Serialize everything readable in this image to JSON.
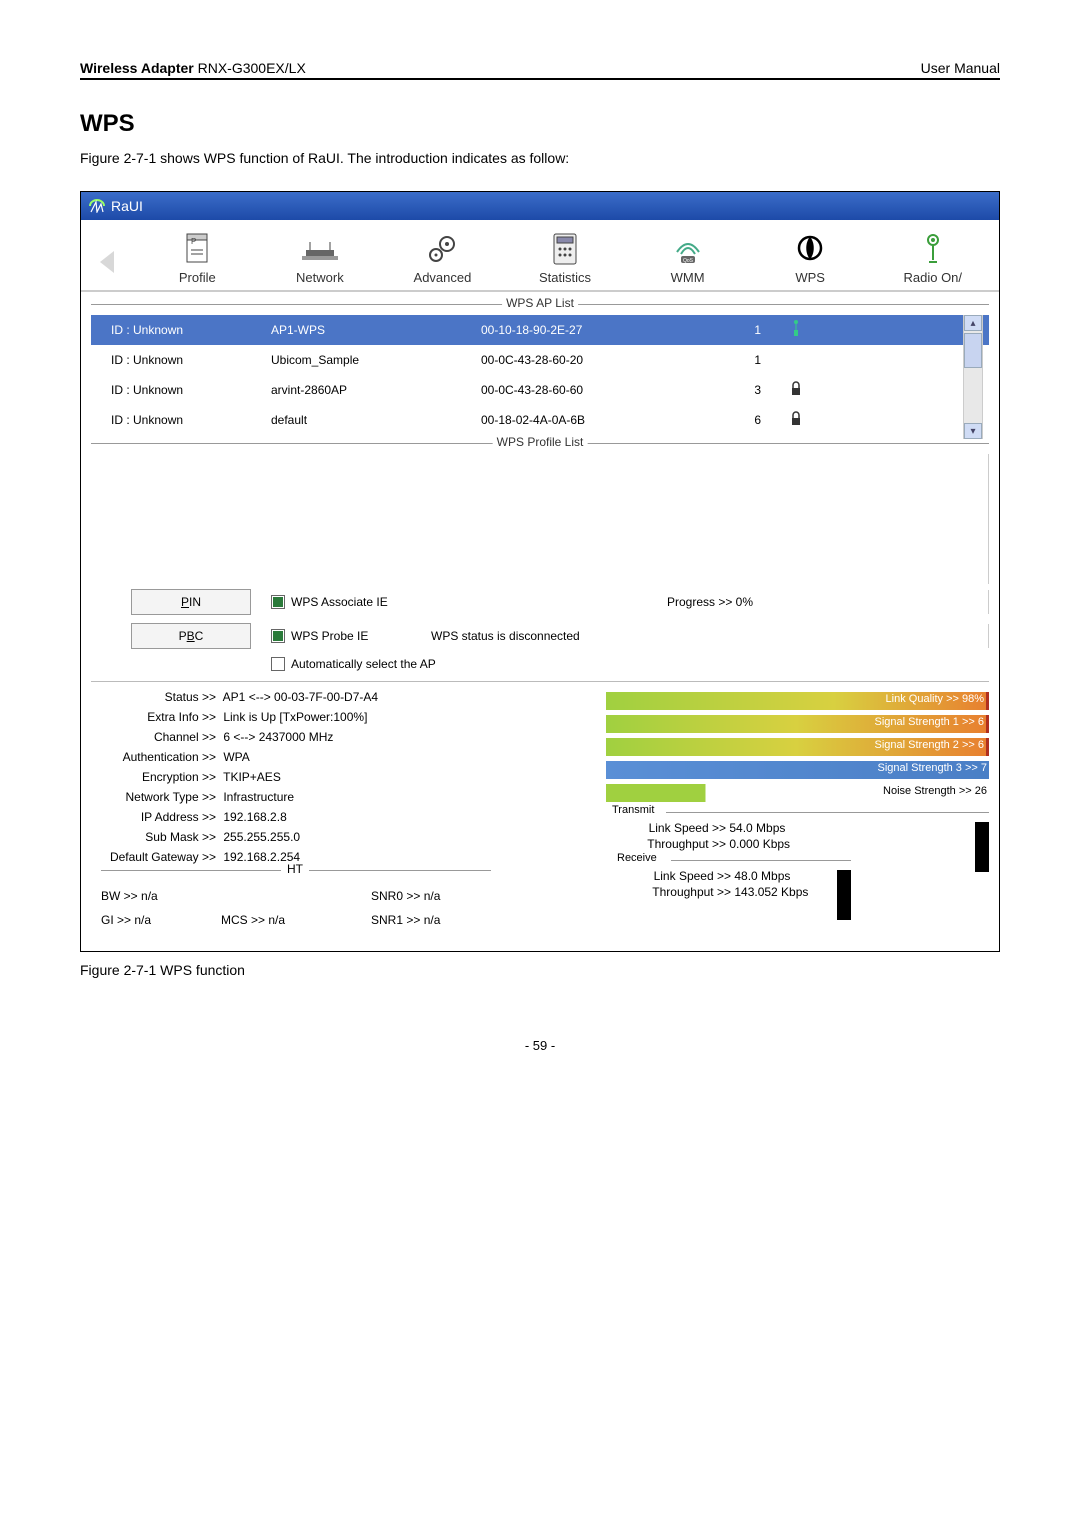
{
  "doc": {
    "header_left_bold": "Wireless Adapter",
    "header_left_rest": " RNX-G300EX/LX",
    "header_right": "User Manual",
    "title": "WPS",
    "intro": "Figure 2-7-1 shows WPS function of RaUI. The introduction indicates as follow:",
    "caption": "Figure 2-7-1 WPS function",
    "page_num": "- 59 -"
  },
  "app": {
    "titlebar": "RaUI",
    "tabs": {
      "profile": "Profile",
      "network": "Network",
      "advanced": "Advanced",
      "statistics": "Statistics",
      "wmm": "WMM",
      "wps": "WPS",
      "radio": "Radio On/"
    },
    "wps_ap_list_label": "WPS AP List",
    "wps_profile_list_label": "WPS Profile List",
    "ap_rows": [
      {
        "id": "ID : Unknown",
        "name": "AP1-WPS",
        "mac": "00-10-18-90-2E-27",
        "ch": "1",
        "lock": false
      },
      {
        "id": "ID : Unknown",
        "name": "Ubicom_Sample",
        "mac": "00-0C-43-28-60-20",
        "ch": "1",
        "lock": false
      },
      {
        "id": "ID : Unknown",
        "name": "arvint-2860AP",
        "mac": "00-0C-43-28-60-60",
        "ch": "3",
        "lock": true
      },
      {
        "id": "ID : Unknown",
        "name": "default",
        "mac": "00-18-02-4A-0A-6B",
        "ch": "6",
        "lock": true
      }
    ],
    "btn_pin": "PIN",
    "btn_pbc": "PBC",
    "cb_assoc": "WPS Associate IE",
    "cb_probe": "WPS Probe IE",
    "cb_auto": "Automatically select the AP",
    "progress": "Progress >> 0%",
    "status_disc": "WPS status is disconnected",
    "info": {
      "status_l": "Status >>",
      "status_v": "AP1 <--> 00-03-7F-00-D7-A4",
      "extra_l": "Extra Info >>",
      "extra_v": "Link is Up [TxPower:100%]",
      "channel_l": "Channel >>",
      "channel_v": "6 <--> 2437000 MHz",
      "auth_l": "Authentication >>",
      "auth_v": "WPA",
      "enc_l": "Encryption >>",
      "enc_v": "TKIP+AES",
      "net_l": "Network Type >>",
      "net_v": "Infrastructure",
      "ip_l": "IP Address >>",
      "ip_v": "192.168.2.8",
      "mask_l": "Sub Mask >>",
      "mask_v": "255.255.255.0",
      "gw_l": "Default Gateway >>",
      "gw_v": "192.168.2.254"
    },
    "signals": {
      "lq": "Link Quality >> 98%",
      "ss1": "Signal Strength 1 >> 6",
      "ss2": "Signal Strength 2 >> 6",
      "ss3": "Signal Strength 3 >> 7",
      "noise": "Noise Strength >> 26"
    },
    "transmit_label": "Transmit",
    "receive_label": "Receive",
    "tx": {
      "ls_l": "Link Speed >>",
      "ls_v": "54.0 Mbps",
      "tp_l": "Throughput >>",
      "tp_v": "0.000 Kbps"
    },
    "rx": {
      "ls_l": "Link Speed >>",
      "ls_v": "48.0 Mbps",
      "tp_l": "Throughput >>",
      "tp_v": "143.052 Kbps"
    },
    "ht_label": "HT",
    "ht": {
      "bw_l": "BW >>",
      "bw_v": "n/a",
      "gi_l": "GI >>",
      "gi_v": "n/a",
      "mcs_l": "MCS >>",
      "mcs_v": "n/a",
      "snr0_l": "SNR0 >>",
      "snr0_v": "n/a",
      "snr1_l": "SNR1 >>",
      "snr1_v": "n/a"
    }
  }
}
